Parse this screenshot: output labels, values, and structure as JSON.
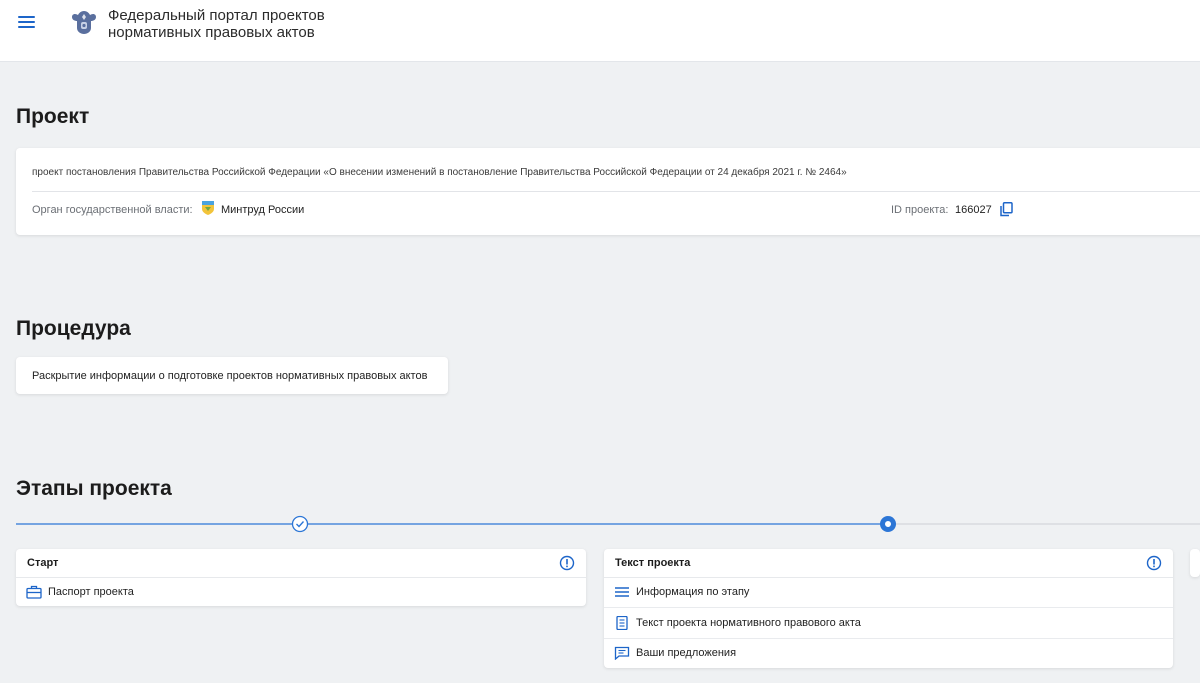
{
  "header": {
    "title_line1": "Федеральный портал проектов",
    "title_line2": "нормативных правовых актов",
    "menu_icon": "hamburger-menu-icon",
    "emblem_icon": "russian-coat-of-arms-icon"
  },
  "project": {
    "heading": "Проект",
    "name": "проект постановления Правительства Российской Федерации «О внесении изменений в постановление Правительства Российской Федерации от 24 декабря 2021 г. № 2464»",
    "gov_body_label": "Орган государственной власти:",
    "gov_body_value": "Минтруд России",
    "id_label": "ID проекта:",
    "id_value": "166027"
  },
  "procedure": {
    "heading": "Процедура",
    "text": "Раскрытие информации о подготовке проектов нормативных правовых актов"
  },
  "stages": {
    "heading": "Этапы проекта",
    "items": [
      {
        "title": "Старт",
        "status": "completed",
        "rows": [
          {
            "label": "Паспорт проекта",
            "icon": "briefcase-icon"
          }
        ]
      },
      {
        "title": "Текст проекта",
        "status": "current",
        "rows": [
          {
            "label": "Информация по этапу",
            "icon": "list-lines-icon"
          },
          {
            "label": "Текст проекта нормативного правового акта",
            "icon": "document-icon"
          },
          {
            "label": "Ваши предложения",
            "icon": "comment-icon"
          }
        ]
      }
    ]
  },
  "colors": {
    "accent": "#1d65c9",
    "background": "#eff1f3",
    "timeline_done": "#2c76d6",
    "timeline_pending": "#d4d7dc"
  }
}
